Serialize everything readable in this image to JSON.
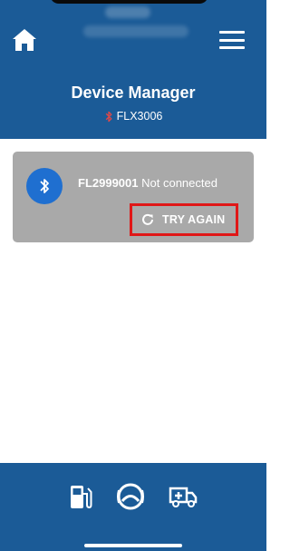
{
  "header": {
    "title": "Device Manager",
    "connected_device": "FLX3006",
    "home_icon": "home-icon",
    "menu_icon": "menu-icon"
  },
  "device_card": {
    "device_id": "FL2999001",
    "status": "Not connected",
    "retry_label": "TRY AGAIN",
    "bluetooth_icon": "bluetooth-icon",
    "refresh_icon": "refresh-icon"
  },
  "bottom_nav": {
    "items": [
      {
        "icon": "fuel-pump-icon"
      },
      {
        "icon": "gauge-ring-icon"
      },
      {
        "icon": "medical-vehicle-icon"
      }
    ]
  },
  "colors": {
    "primary": "#1b5b97",
    "card": "#a9a9a9",
    "bluetooth_circle": "#1f6fd0",
    "highlight": "#e01717",
    "bluetooth_small": "#e04848"
  }
}
